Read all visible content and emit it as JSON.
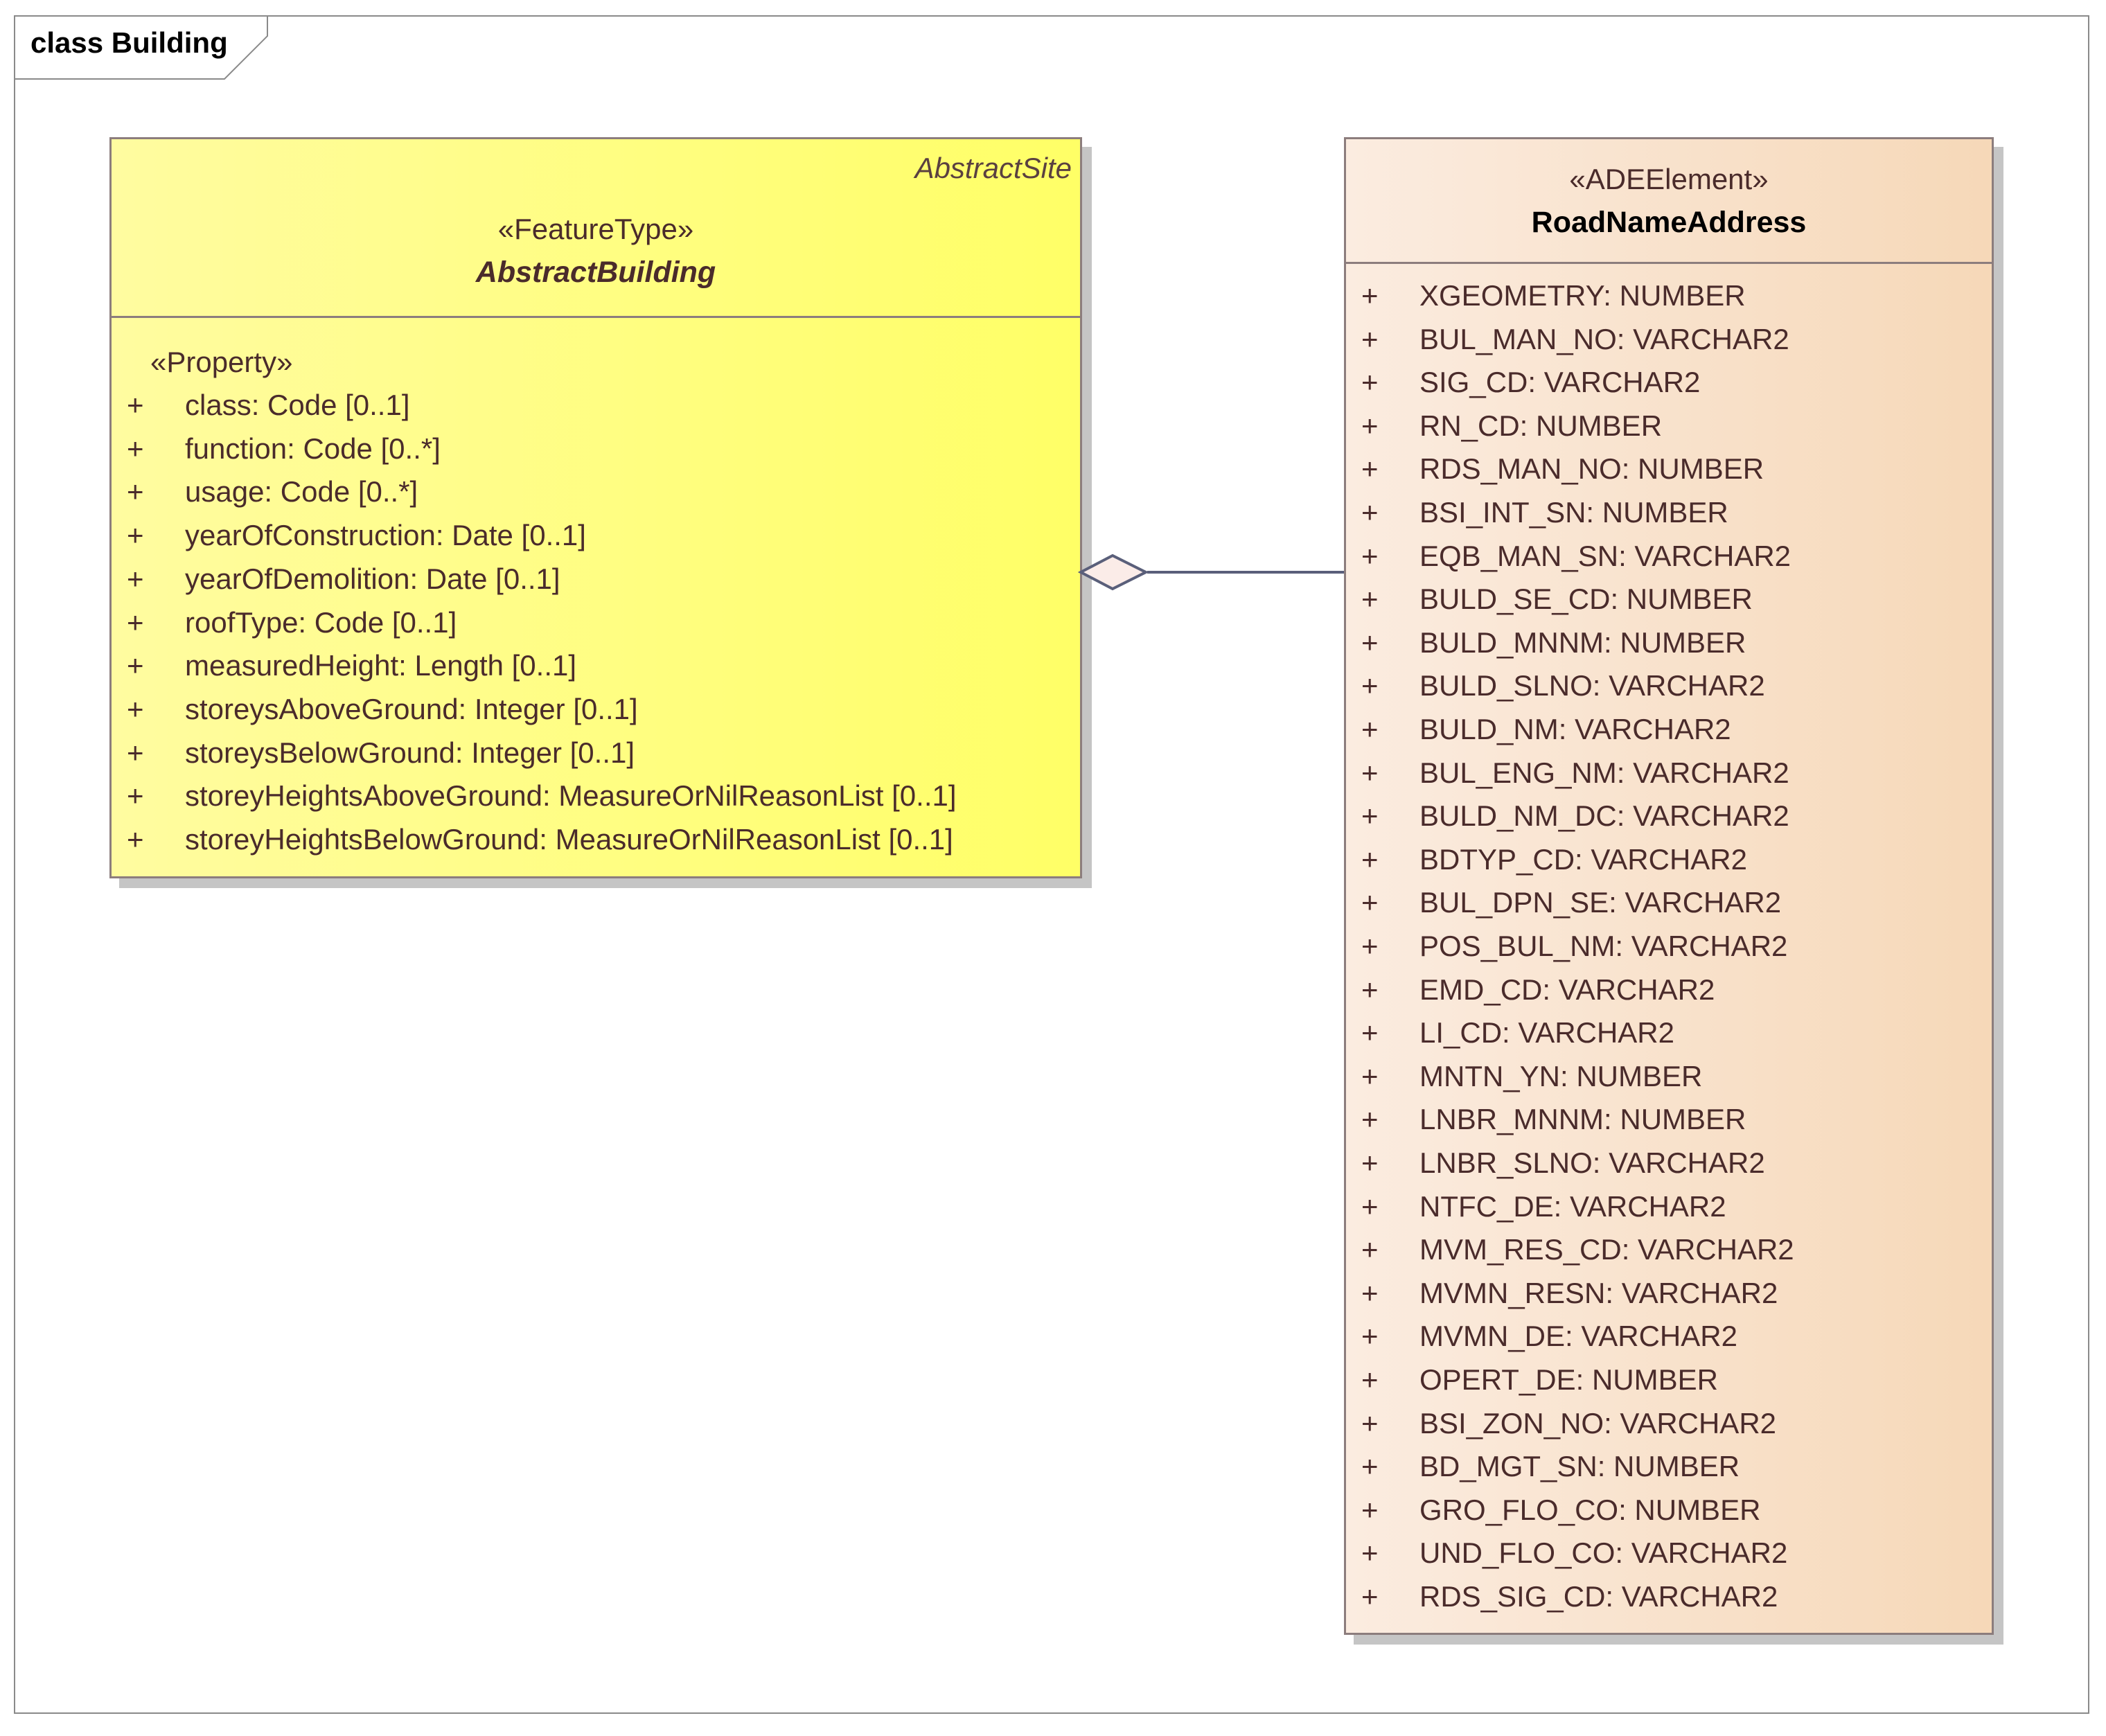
{
  "frame": {
    "title": "class Building"
  },
  "abstract_building": {
    "parent": "AbstractSite",
    "stereotype": "«FeatureType»",
    "name": "AbstractBuilding",
    "attribute_stereotype": "«Property»",
    "attributes": [
      {
        "vis": "+",
        "text": "class: Code [0..1]"
      },
      {
        "vis": "+",
        "text": "function: Code [0..*]"
      },
      {
        "vis": "+",
        "text": "usage: Code [0..*]"
      },
      {
        "vis": "+",
        "text": "yearOfConstruction: Date [0..1]"
      },
      {
        "vis": "+",
        "text": "yearOfDemolition: Date [0..1]"
      },
      {
        "vis": "+",
        "text": "roofType: Code [0..1]"
      },
      {
        "vis": "+",
        "text": "measuredHeight: Length [0..1]"
      },
      {
        "vis": "+",
        "text": "storeysAboveGround: Integer [0..1]"
      },
      {
        "vis": "+",
        "text": "storeysBelowGround: Integer [0..1]"
      },
      {
        "vis": "+",
        "text": "storeyHeightsAboveGround: MeasureOrNilReasonList [0..1]"
      },
      {
        "vis": "+",
        "text": "storeyHeightsBelowGround: MeasureOrNilReasonList [0..1]"
      }
    ]
  },
  "road_name_address": {
    "stereotype": "«ADEElement»",
    "name": "RoadNameAddress",
    "attributes": [
      {
        "vis": "+",
        "text": "XGEOMETRY: NUMBER"
      },
      {
        "vis": "+",
        "text": "BUL_MAN_NO: VARCHAR2"
      },
      {
        "vis": "+",
        "text": "SIG_CD: VARCHAR2"
      },
      {
        "vis": "+",
        "text": "RN_CD: NUMBER"
      },
      {
        "vis": "+",
        "text": "RDS_MAN_NO: NUMBER"
      },
      {
        "vis": "+",
        "text": "BSI_INT_SN: NUMBER"
      },
      {
        "vis": "+",
        "text": "EQB_MAN_SN: VARCHAR2"
      },
      {
        "vis": "+",
        "text": "BULD_SE_CD: NUMBER"
      },
      {
        "vis": "+",
        "text": "BULD_MNNM: NUMBER"
      },
      {
        "vis": "+",
        "text": "BULD_SLNO: VARCHAR2"
      },
      {
        "vis": "+",
        "text": "BULD_NM: VARCHAR2"
      },
      {
        "vis": "+",
        "text": "BUL_ENG_NM: VARCHAR2"
      },
      {
        "vis": "+",
        "text": "BULD_NM_DC: VARCHAR2"
      },
      {
        "vis": "+",
        "text": "BDTYP_CD: VARCHAR2"
      },
      {
        "vis": "+",
        "text": "BUL_DPN_SE: VARCHAR2"
      },
      {
        "vis": "+",
        "text": "POS_BUL_NM: VARCHAR2"
      },
      {
        "vis": "+",
        "text": "EMD_CD: VARCHAR2"
      },
      {
        "vis": "+",
        "text": "LI_CD: VARCHAR2"
      },
      {
        "vis": "+",
        "text": "MNTN_YN: NUMBER"
      },
      {
        "vis": "+",
        "text": "LNBR_MNNM: NUMBER"
      },
      {
        "vis": "+",
        "text": "LNBR_SLNO: VARCHAR2"
      },
      {
        "vis": "+",
        "text": "NTFC_DE: VARCHAR2"
      },
      {
        "vis": "+",
        "text": "MVM_RES_CD: VARCHAR2"
      },
      {
        "vis": "+",
        "text": "MVMN_RESN: VARCHAR2"
      },
      {
        "vis": "+",
        "text": "MVMN_DE: VARCHAR2"
      },
      {
        "vis": "+",
        "text": "OPERT_DE: NUMBER"
      },
      {
        "vis": "+",
        "text": "BSI_ZON_NO: VARCHAR2"
      },
      {
        "vis": "+",
        "text": "BD_MGT_SN: NUMBER"
      },
      {
        "vis": "+",
        "text": "GRO_FLO_CO: NUMBER"
      },
      {
        "vis": "+",
        "text": "UND_FLO_CO: VARCHAR2"
      },
      {
        "vis": "+",
        "text": "RDS_SIG_CD: VARCHAR2"
      }
    ]
  },
  "association": {
    "kind": "aggregation",
    "colors": {
      "line": "#5a5f7a",
      "diamond_fill": "#fbece8"
    }
  },
  "colors": {
    "feature_type_fill": "#ffff66",
    "ade_element_fill": "#f6d8b8",
    "border": "#8c7d7d",
    "text": "#4a2b2b"
  }
}
